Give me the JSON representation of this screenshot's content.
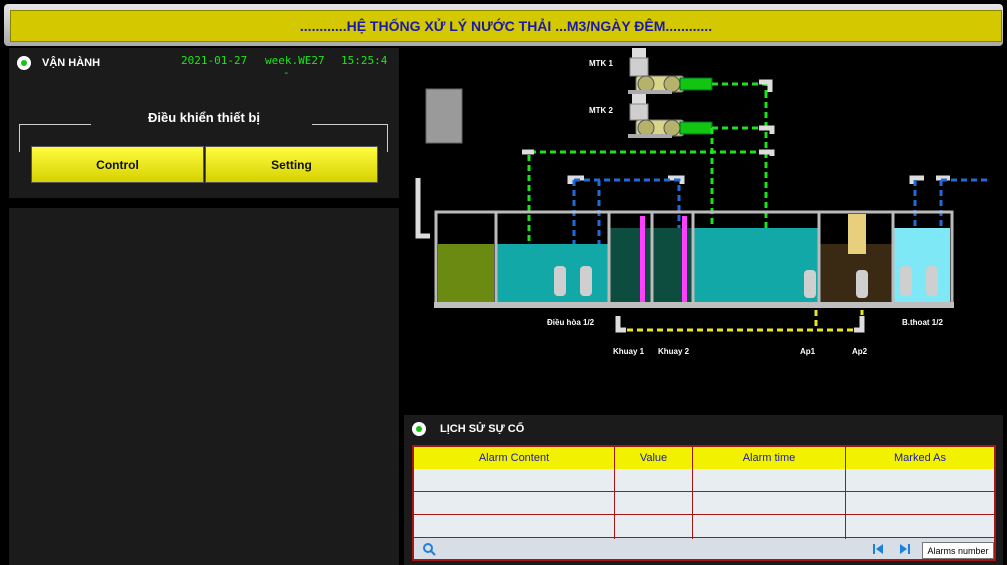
{
  "header": {
    "title": "............HỆ THỐNG XỬ LÝ NƯỚC THẢI ...M3/NGÀY ĐÊM............"
  },
  "operation": {
    "title": "VẬN HÀNH",
    "date": "2021-01-27",
    "week": "week.WE27",
    "time": "15:25:4",
    "time_suffix": "-",
    "group_title": "Điều khiển thiết bị",
    "control_label": "Control",
    "setting_label": "Setting"
  },
  "diagram": {
    "labels": {
      "mtk1": "MTK 1",
      "mtk2": "MTK 2",
      "dieuhoa": "Điều hòa 1/2",
      "khuay1": "Khuay 1",
      "khuay2": "Khuay 2",
      "ap1": "Ap1",
      "ap2": "Ap2",
      "bthoat": "B.thoat 1/2"
    },
    "colors": {
      "air_line": "#1ee01e",
      "water_line": "#1f6bd8",
      "sludge_line": "#e8e820",
      "tank_water": "#12a8a8",
      "mix_paddle": "#ff40ff"
    }
  },
  "alarm": {
    "title": "LỊCH SỬ SỰ CỐ",
    "columns": [
      "Alarm Content",
      "Value",
      "Alarm time",
      "Marked As"
    ],
    "rows": [
      [
        "",
        "",
        "",
        ""
      ],
      [
        "",
        "",
        "",
        ""
      ],
      [
        "",
        "",
        "",
        ""
      ]
    ],
    "alarms_number_label": "Alarms number"
  }
}
